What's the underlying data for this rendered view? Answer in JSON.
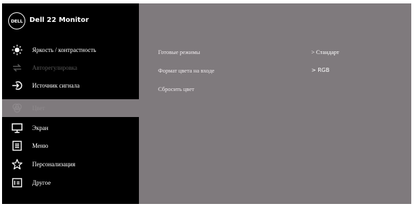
{
  "header": {
    "logo_text": "DELL",
    "title": "Dell 22 Monitor"
  },
  "menu": {
    "items": [
      {
        "label": "Яркость / контрастность",
        "icon": "brightness-icon",
        "state": "normal"
      },
      {
        "label": "Авторегулировка",
        "icon": "auto-adjust-icon",
        "state": "disabled"
      },
      {
        "label": "Источник сигнала",
        "icon": "input-source-icon",
        "state": "normal"
      },
      {
        "label": "Цвет",
        "icon": "color-icon",
        "state": "selected"
      },
      {
        "label": "Экран",
        "icon": "display-icon",
        "state": "normal"
      },
      {
        "label": "Меню",
        "icon": "menu-icon",
        "state": "normal"
      },
      {
        "label": "Персонализация",
        "icon": "star-icon",
        "state": "normal"
      },
      {
        "label": "Другое",
        "icon": "other-icon",
        "state": "normal"
      }
    ]
  },
  "content": {
    "rows": [
      {
        "label": "Готовые режимы",
        "value": "> Стандарт"
      },
      {
        "label": "Формат цвета на входе",
        "value": "> RGB"
      },
      {
        "label": "Сбросить цвет",
        "value": ""
      }
    ]
  },
  "colors": {
    "osd_background": "#000000",
    "content_background": "#7f7a7d",
    "disabled_text": "#555555"
  }
}
